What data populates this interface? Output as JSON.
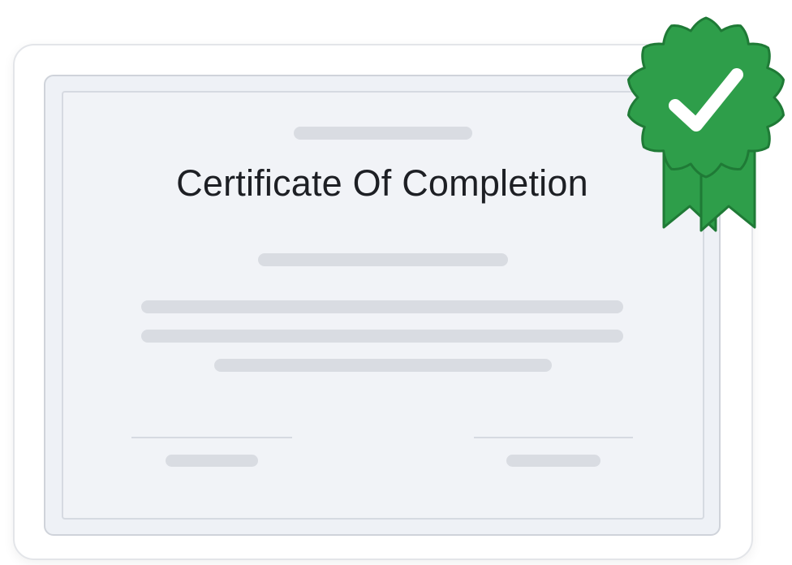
{
  "certificate": {
    "title": "Certificate Of Completion"
  },
  "seal": {
    "icon": "checkmark-badge-icon",
    "color": "#2e9e4a",
    "check_color": "#ffffff"
  }
}
